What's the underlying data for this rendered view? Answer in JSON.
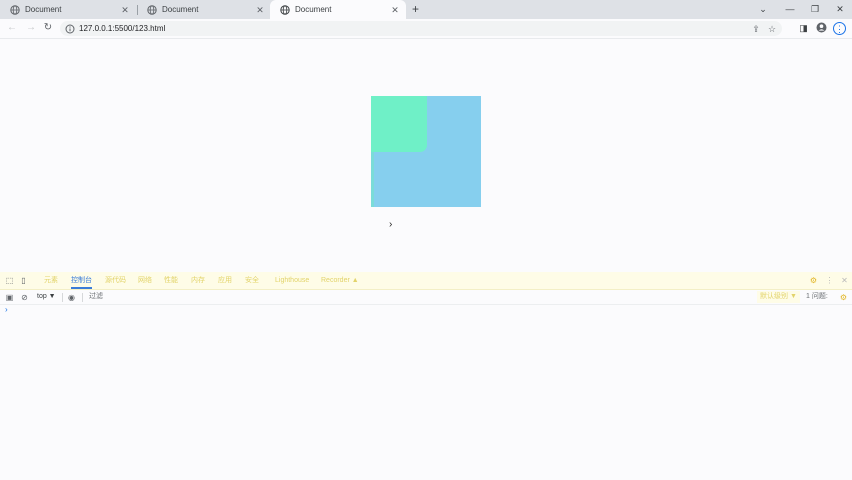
{
  "browser": {
    "tabs": [
      {
        "title": "Document",
        "active": false
      },
      {
        "title": "Document",
        "active": false
      },
      {
        "title": "Document",
        "active": true
      }
    ],
    "new_tab_label": "+",
    "url": "127.0.0.1:5500/123.html"
  },
  "page": {
    "square_colors": {
      "green": "#6ff0c7",
      "blue": "#86cfee"
    }
  },
  "devtools": {
    "tabs": [
      "元素",
      "控制台",
      "源代码",
      "网络",
      "性能",
      "内存",
      "应用",
      "安全",
      "Lighthouse",
      "Recorder ▲"
    ],
    "active_tab": "控制台",
    "context": "top ▼",
    "filter_placeholder": "过滤",
    "levels": "默认级别 ▼",
    "issues": "1 问题:",
    "prompt": "›"
  }
}
